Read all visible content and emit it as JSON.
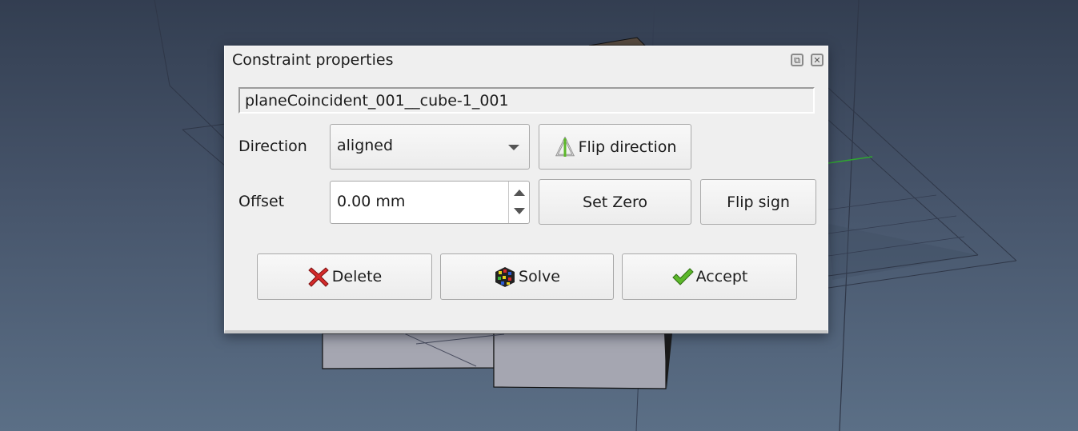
{
  "dialog": {
    "title": "Constraint properties",
    "float_button_icon": "float-window-icon",
    "close_button_icon": "close-icon",
    "constraint_name": "planeCoincident_001__cube-1_001",
    "direction": {
      "label": "Direction",
      "selected": "aligned",
      "flip_button": {
        "label": "Flip direction",
        "icon": "flip-direction-icon"
      }
    },
    "offset": {
      "label": "Offset",
      "value": "0.00 mm",
      "set_zero_label": "Set Zero",
      "flip_sign_label": "Flip sign"
    },
    "actions": {
      "delete": {
        "label": "Delete",
        "icon": "delete-x-icon"
      },
      "solve": {
        "label": "Solve",
        "icon": "rubiks-cube-icon"
      },
      "accept": {
        "label": "Accept",
        "icon": "checkmark-icon"
      }
    }
  },
  "colors": {
    "viewport_top": "#333e51",
    "viewport_bottom": "#5b6f86",
    "dialog_bg": "#efefef",
    "accent_green": "#5cb82a",
    "delete_red": "#d42a2a",
    "axis_green": "#2fa82f",
    "shape_face": "#a5a6b1"
  }
}
